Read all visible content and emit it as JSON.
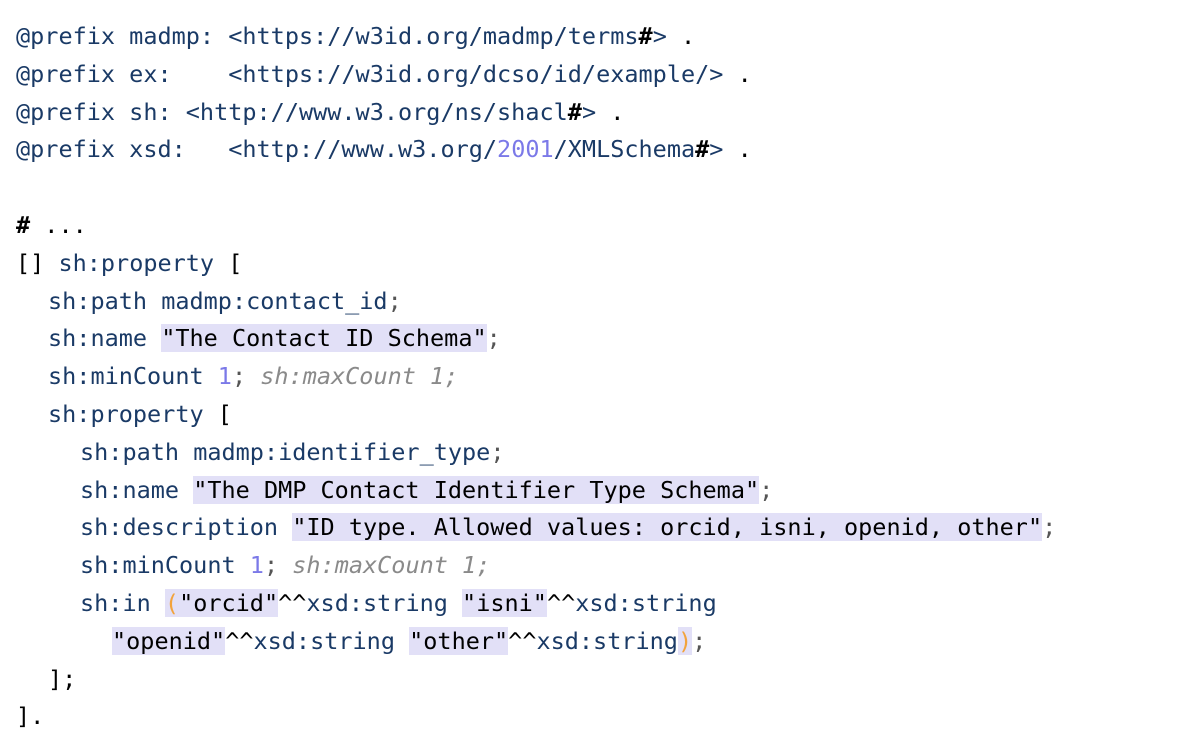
{
  "document": {
    "title": "SHACL Turtle code listing",
    "language": "turtle",
    "colors": {
      "background": "#ffffff",
      "keyword": "#1a3a66",
      "number": "#7b79e8",
      "literal_text": "#000000",
      "literal_highlight": "#e2e0f7",
      "paren": "#f2a33c",
      "comment_italic": "#8a8a8a",
      "punctuation": "#555555",
      "plain": "#000000"
    }
  },
  "lines": [
    {
      "id": "line-1",
      "indent": 0,
      "tokens": [
        {
          "text": "@prefix madmp: <https://w3id.org/madmp/terms",
          "style": "kw"
        },
        {
          "text": "#",
          "style": "hash"
        },
        {
          "text": ">",
          "style": "kw"
        },
        {
          "text": " .",
          "style": "plain"
        }
      ]
    },
    {
      "id": "line-2",
      "indent": 0,
      "tokens": [
        {
          "text": "@prefix ex:    <https://w3id.org/dcso/id/example/>",
          "style": "kw"
        },
        {
          "text": " .",
          "style": "plain"
        }
      ]
    },
    {
      "id": "line-3",
      "indent": 0,
      "tokens": [
        {
          "text": "@prefix sh: <http://www.w3.org/ns/shacl",
          "style": "kw"
        },
        {
          "text": "#",
          "style": "hash"
        },
        {
          "text": ">",
          "style": "kw"
        },
        {
          "text": " .",
          "style": "plain"
        }
      ]
    },
    {
      "id": "line-4",
      "indent": 0,
      "tokens": [
        {
          "text": "@prefix xsd:   <http://www.w3.org/",
          "style": "kw"
        },
        {
          "text": "2001",
          "style": "num"
        },
        {
          "text": "/XMLSchema",
          "style": "kw"
        },
        {
          "text": "#",
          "style": "hash"
        },
        {
          "text": ">",
          "style": "kw"
        },
        {
          "text": " .",
          "style": "plain"
        }
      ]
    },
    {
      "id": "line-5",
      "indent": 0,
      "blank": true,
      "tokens": []
    },
    {
      "id": "line-6",
      "indent": 0,
      "tokens": [
        {
          "text": "#",
          "style": "hash"
        },
        {
          "text": " ...",
          "style": "plain"
        }
      ]
    },
    {
      "id": "line-7",
      "indent": 0,
      "tokens": [
        {
          "text": "[] ",
          "style": "plain"
        },
        {
          "text": "sh:property",
          "style": "kw"
        },
        {
          "text": " [",
          "style": "plain"
        }
      ]
    },
    {
      "id": "line-8",
      "indent": 1,
      "tokens": [
        {
          "text": "sh:path",
          "style": "kw"
        },
        {
          "text": " ",
          "style": "plain"
        },
        {
          "text": "madmp:contact_id",
          "style": "kw"
        },
        {
          "text": ";",
          "style": "punct"
        }
      ]
    },
    {
      "id": "line-9",
      "indent": 1,
      "tokens": [
        {
          "text": "sh:name",
          "style": "kw"
        },
        {
          "text": " ",
          "style": "plain"
        },
        {
          "text": "\"The Contact ID Schema\"",
          "style": "lit"
        },
        {
          "text": ";",
          "style": "punct"
        }
      ]
    },
    {
      "id": "line-10",
      "indent": 1,
      "tokens": [
        {
          "text": "sh:minCount",
          "style": "kw"
        },
        {
          "text": " ",
          "style": "plain"
        },
        {
          "text": "1",
          "style": "num"
        },
        {
          "text": ";",
          "style": "punct"
        },
        {
          "text": " ",
          "style": "plain"
        },
        {
          "text": "sh:maxCount 1;",
          "style": "italic"
        }
      ]
    },
    {
      "id": "line-11",
      "indent": 1,
      "tokens": [
        {
          "text": "sh:property",
          "style": "kw"
        },
        {
          "text": " [",
          "style": "plain"
        }
      ]
    },
    {
      "id": "line-12",
      "indent": 2,
      "tokens": [
        {
          "text": "sh:path",
          "style": "kw"
        },
        {
          "text": " ",
          "style": "plain"
        },
        {
          "text": "madmp:identifier_type",
          "style": "kw"
        },
        {
          "text": ";",
          "style": "punct"
        }
      ]
    },
    {
      "id": "line-13",
      "indent": 2,
      "tokens": [
        {
          "text": "sh:name",
          "style": "kw"
        },
        {
          "text": " ",
          "style": "plain"
        },
        {
          "text": "\"The DMP Contact Identifier Type Schema\"",
          "style": "lit"
        },
        {
          "text": ";",
          "style": "punct"
        }
      ]
    },
    {
      "id": "line-14",
      "indent": 2,
      "tokens": [
        {
          "text": "sh:description",
          "style": "kw"
        },
        {
          "text": " ",
          "style": "plain"
        },
        {
          "text": "\"ID type. Allowed values: orcid, isni, openid, other\"",
          "style": "lit"
        },
        {
          "text": ";",
          "style": "punct"
        }
      ]
    },
    {
      "id": "line-15",
      "indent": 2,
      "tokens": [
        {
          "text": "sh:minCount",
          "style": "kw"
        },
        {
          "text": " ",
          "style": "plain"
        },
        {
          "text": "1",
          "style": "num"
        },
        {
          "text": ";",
          "style": "punct"
        },
        {
          "text": " ",
          "style": "plain"
        },
        {
          "text": "sh:maxCount 1;",
          "style": "italic"
        }
      ]
    },
    {
      "id": "line-16",
      "indent": 2,
      "tokens": [
        {
          "text": "sh:in",
          "style": "kw"
        },
        {
          "text": " ",
          "style": "plain"
        },
        {
          "text": "(",
          "style": "paren-hl"
        },
        {
          "text": "\"orcid\"",
          "style": "lit"
        },
        {
          "text": "^^",
          "style": "plain"
        },
        {
          "text": "xsd:string",
          "style": "kw"
        },
        {
          "text": " ",
          "style": "plain"
        },
        {
          "text": "\"isni\"",
          "style": "lit"
        },
        {
          "text": "^^",
          "style": "plain"
        },
        {
          "text": "xsd:string",
          "style": "kw"
        }
      ]
    },
    {
      "id": "line-17",
      "indent": 3,
      "tokens": [
        {
          "text": "\"openid\"",
          "style": "lit"
        },
        {
          "text": "^^",
          "style": "plain"
        },
        {
          "text": "xsd:string",
          "style": "kw"
        },
        {
          "text": " ",
          "style": "plain"
        },
        {
          "text": "\"other\"",
          "style": "lit"
        },
        {
          "text": "^^",
          "style": "plain"
        },
        {
          "text": "xsd:string",
          "style": "kw"
        },
        {
          "text": ")",
          "style": "paren-hl"
        },
        {
          "text": ";",
          "style": "punct"
        }
      ]
    },
    {
      "id": "line-18",
      "indent": 1,
      "tokens": [
        {
          "text": "];",
          "style": "plain"
        }
      ]
    },
    {
      "id": "line-19",
      "indent": 0,
      "tokens": [
        {
          "text": "].",
          "style": "plain"
        }
      ]
    }
  ]
}
